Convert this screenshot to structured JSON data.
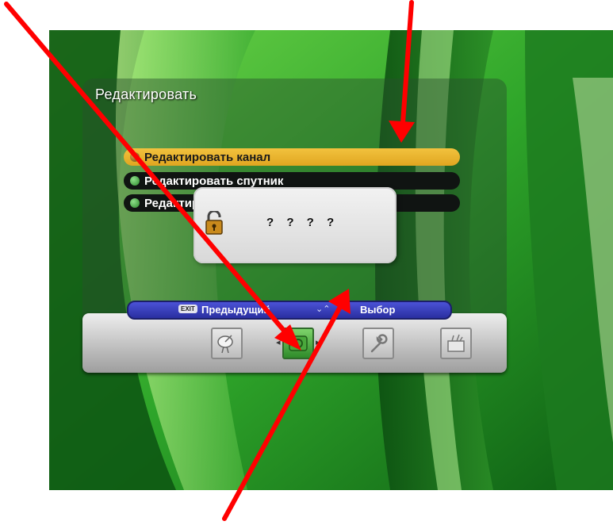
{
  "menu": {
    "title": "Редактировать",
    "items": [
      {
        "label": "Редактировать канал",
        "selected": true
      },
      {
        "label": "Редактировать спутник",
        "selected": false
      },
      {
        "label": "Редактировать транспондер",
        "selected": false
      }
    ]
  },
  "pin_dialog": {
    "value": "? ? ? ?",
    "icon": "unlocked-padlock-icon"
  },
  "help_bar": {
    "exit_key": "EXIT",
    "prev_label": "Предыдущий",
    "nav_keys": "⌄⌃",
    "select_label": "Выбор"
  },
  "toolbar": {
    "tools": [
      {
        "icon": "satellite-dish-icon"
      },
      {
        "icon": "edit-channel-icon",
        "active": true
      },
      {
        "icon": "wrench-icon"
      },
      {
        "icon": "toolbox-icon"
      }
    ]
  },
  "colors": {
    "selected_item": "#f2c23e",
    "item_bg": "#101412",
    "help_bar": "#3a40c0",
    "annotation_arrow": "#ff0000"
  }
}
